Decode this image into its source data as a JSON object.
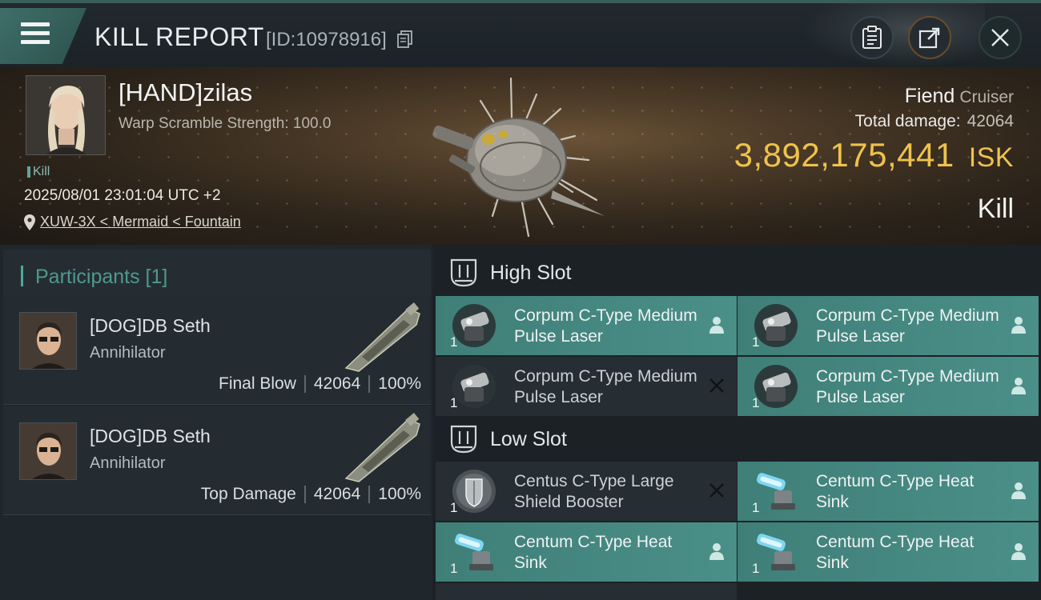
{
  "header": {
    "title": "KILL REPORT",
    "id_text": "[ID:10978916]"
  },
  "victim": {
    "name": "[HAND]zilas",
    "warp_scramble": "Warp Scramble Strength: 100.0",
    "tag": "Kill",
    "datetime": "2025/08/01 23:01:04 UTC +2",
    "location": "XUW-3X < Mermaid < Fountain",
    "ship": "Fiend",
    "ship_class": "Cruiser",
    "total_damage_label": "Total damage:",
    "total_damage": "42064",
    "isk_value": "3,892,175,441",
    "isk_unit": "ISK",
    "result": "Kill"
  },
  "participants": {
    "heading": "Participants [1]",
    "items": [
      {
        "name": "[DOG]DB Seth",
        "ship": "Annihilator",
        "role": "Final Blow",
        "damage": "42064",
        "percent": "100%"
      },
      {
        "name": "[DOG]DB Seth",
        "ship": "Annihilator",
        "role": "Top Damage",
        "damage": "42064",
        "percent": "100%"
      }
    ]
  },
  "fitting": {
    "high_slot_label": "High Slot",
    "low_slot_label": "Low Slot",
    "high": [
      {
        "name": "Corpum C-Type Medium Pulse Laser",
        "qty": "1",
        "status": "dropped",
        "icon": "laser-turret-icon"
      },
      {
        "name": "Corpum C-Type Medium Pulse Laser",
        "qty": "1",
        "status": "dropped",
        "icon": "laser-turret-icon"
      },
      {
        "name": "Corpum C-Type Medium Pulse Laser",
        "qty": "1",
        "status": "destroyed",
        "icon": "laser-turret-icon"
      },
      {
        "name": "Corpum C-Type Medium Pulse Laser",
        "qty": "1",
        "status": "dropped",
        "icon": "laser-turret-icon"
      }
    ],
    "low": [
      {
        "name": "Centus C-Type Large Shield Booster",
        "qty": "1",
        "status": "destroyed",
        "icon": "shield-booster-icon"
      },
      {
        "name": "Centum C-Type Heat Sink",
        "qty": "1",
        "status": "dropped",
        "icon": "heat-sink-icon"
      },
      {
        "name": "Centum C-Type Heat Sink",
        "qty": "1",
        "status": "dropped",
        "icon": "heat-sink-icon"
      },
      {
        "name": "Centum C-Type Heat Sink",
        "qty": "1",
        "status": "dropped",
        "icon": "heat-sink-icon"
      }
    ]
  },
  "colors": {
    "accent_teal": "#4a8f88",
    "isk_gold": "#efc24d",
    "participants_heading": "#4e9a90"
  }
}
